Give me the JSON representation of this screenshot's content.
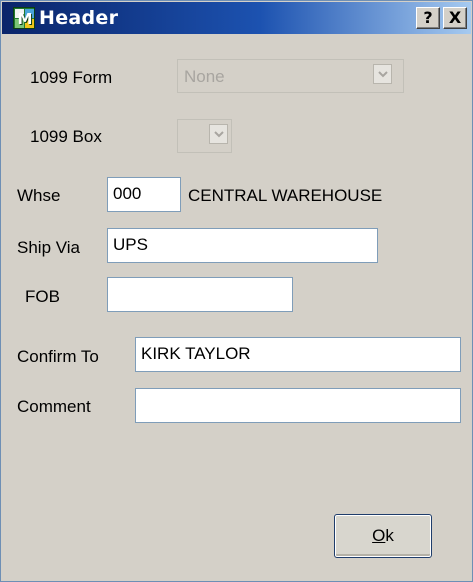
{
  "window": {
    "title": "Header",
    "help_label": "?",
    "close_label": "X",
    "icon_letter": "M"
  },
  "form": {
    "form_1099": {
      "label": "1099 Form",
      "value": "None",
      "enabled": false
    },
    "box_1099": {
      "label": "1099 Box",
      "value": "",
      "enabled": false
    },
    "whse": {
      "label": "Whse",
      "value": "000",
      "description": "CENTRAL WAREHOUSE"
    },
    "ship_via": {
      "label": "Ship Via",
      "value": "UPS"
    },
    "fob": {
      "label": "FOB",
      "value": ""
    },
    "confirm_to": {
      "label": "Confirm To",
      "value": "KIRK TAYLOR"
    },
    "comment": {
      "label": "Comment",
      "value": ""
    }
  },
  "buttons": {
    "ok_mnemonic": "O",
    "ok_rest": "k"
  },
  "colors": {
    "titlebar_start": "#0a246a",
    "titlebar_end": "#a6caf0",
    "window_bg": "#d4d0c8",
    "field_border": "#7f9db9"
  },
  "icons": [
    "app-icon",
    "help-icon",
    "close-icon",
    "chevron-down-icon"
  ]
}
